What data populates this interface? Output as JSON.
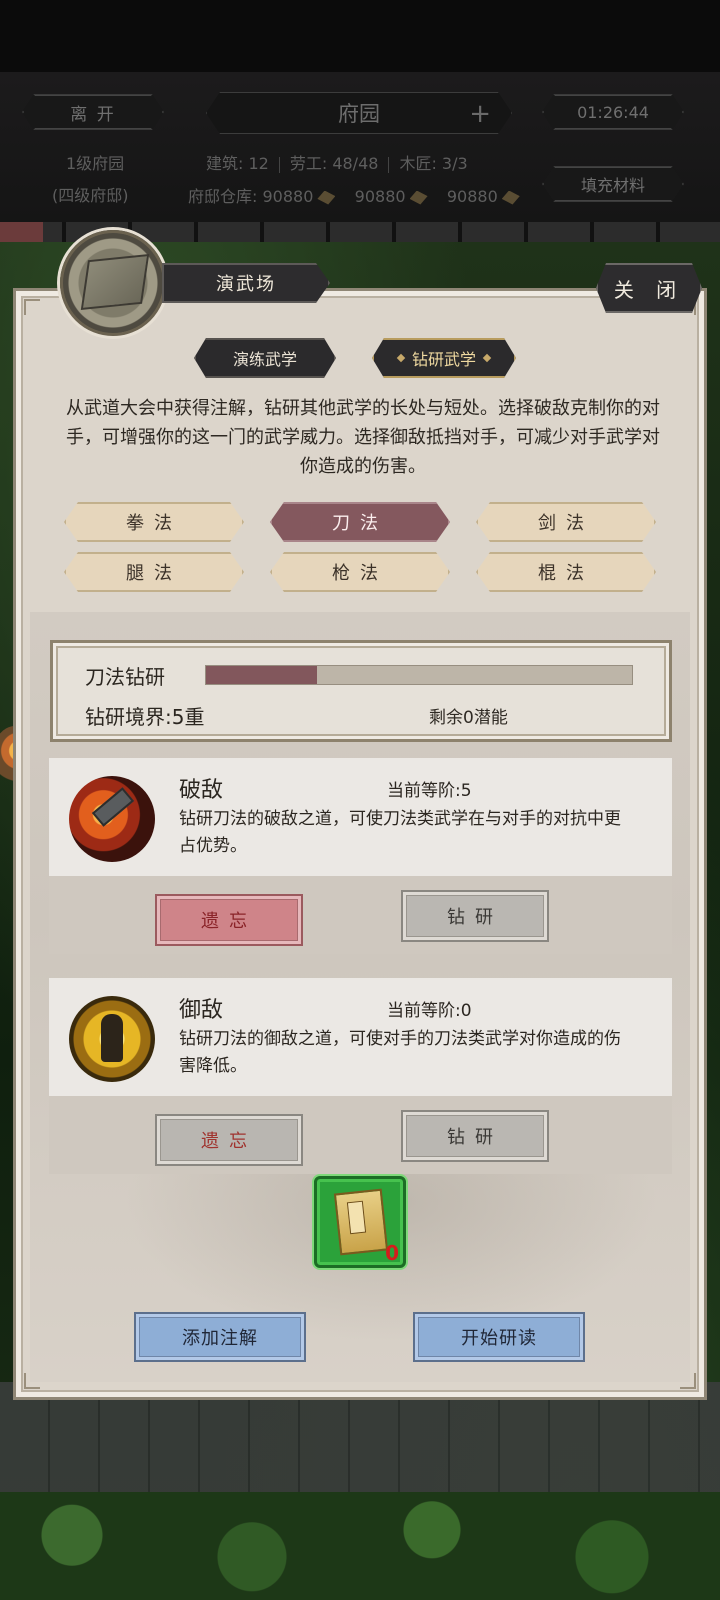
{
  "hud": {
    "leave_label": "离 开",
    "title": "府园",
    "plus_label": "+",
    "timer": "01:26:44",
    "level_line1": "1级府园",
    "level_line2": "(四级府邸)",
    "buildings": "建筑: 12",
    "workers": "劳工: 48/48",
    "carpenters": "木匠: 3/3",
    "warehouse_label": "府邸仓库:",
    "res1": "90880",
    "res2": "90880",
    "res3": "90880",
    "fill_materials_label": "填充材料",
    "progress": 0.06
  },
  "panel": {
    "facility_name": "演武场",
    "close_label": "关 闭",
    "tabs": [
      {
        "label": "演练武学",
        "active": false
      },
      {
        "label": "钻研武学",
        "active": true
      }
    ],
    "description": "从武道大会中获得注解，钻研其他武学的长处与短处。选择破敌克制你的对手，可增强你的这一门的武学威力。选择御敌抵挡对手，可减少对手武学对你造成的伤害。",
    "categories": [
      {
        "label": "拳法",
        "active": false
      },
      {
        "label": "刀法",
        "active": true
      },
      {
        "label": "剑法",
        "active": false
      },
      {
        "label": "腿法",
        "active": false
      },
      {
        "label": "枪法",
        "active": false
      },
      {
        "label": "棍法",
        "active": false
      }
    ],
    "research": {
      "title": "刀法钻研",
      "progress": 0.26,
      "realm": "钻研境界:5重",
      "potential": "剩余0潜能"
    },
    "skills": [
      {
        "icon": "shattering-hammer-icon",
        "name": "破敌",
        "level": "当前等阶:5",
        "desc": "钻研刀法的破敌之道，可使刀法类武学在与对手的对抗中更占优势。",
        "forget_label": "遗忘",
        "study_label": "钻研"
      },
      {
        "icon": "guarding-warrior-icon",
        "name": "御敌",
        "level": "当前等阶:0",
        "desc": "钻研刀法的御敌之道，可使对手的刀法类武学对你造成的伤害降低。",
        "forget_label": "遗忘",
        "study_label": "钻研"
      }
    ],
    "item": {
      "icon": "blade-manual-book-icon",
      "count": "0"
    },
    "add_annotation_label": "添加注解",
    "start_reading_label": "开始研读"
  },
  "colors": {
    "accent": "#84585e",
    "panel_bg": "#dcd5cb",
    "action_blue": "#8eaed6",
    "item_green": "#2ba23a"
  }
}
